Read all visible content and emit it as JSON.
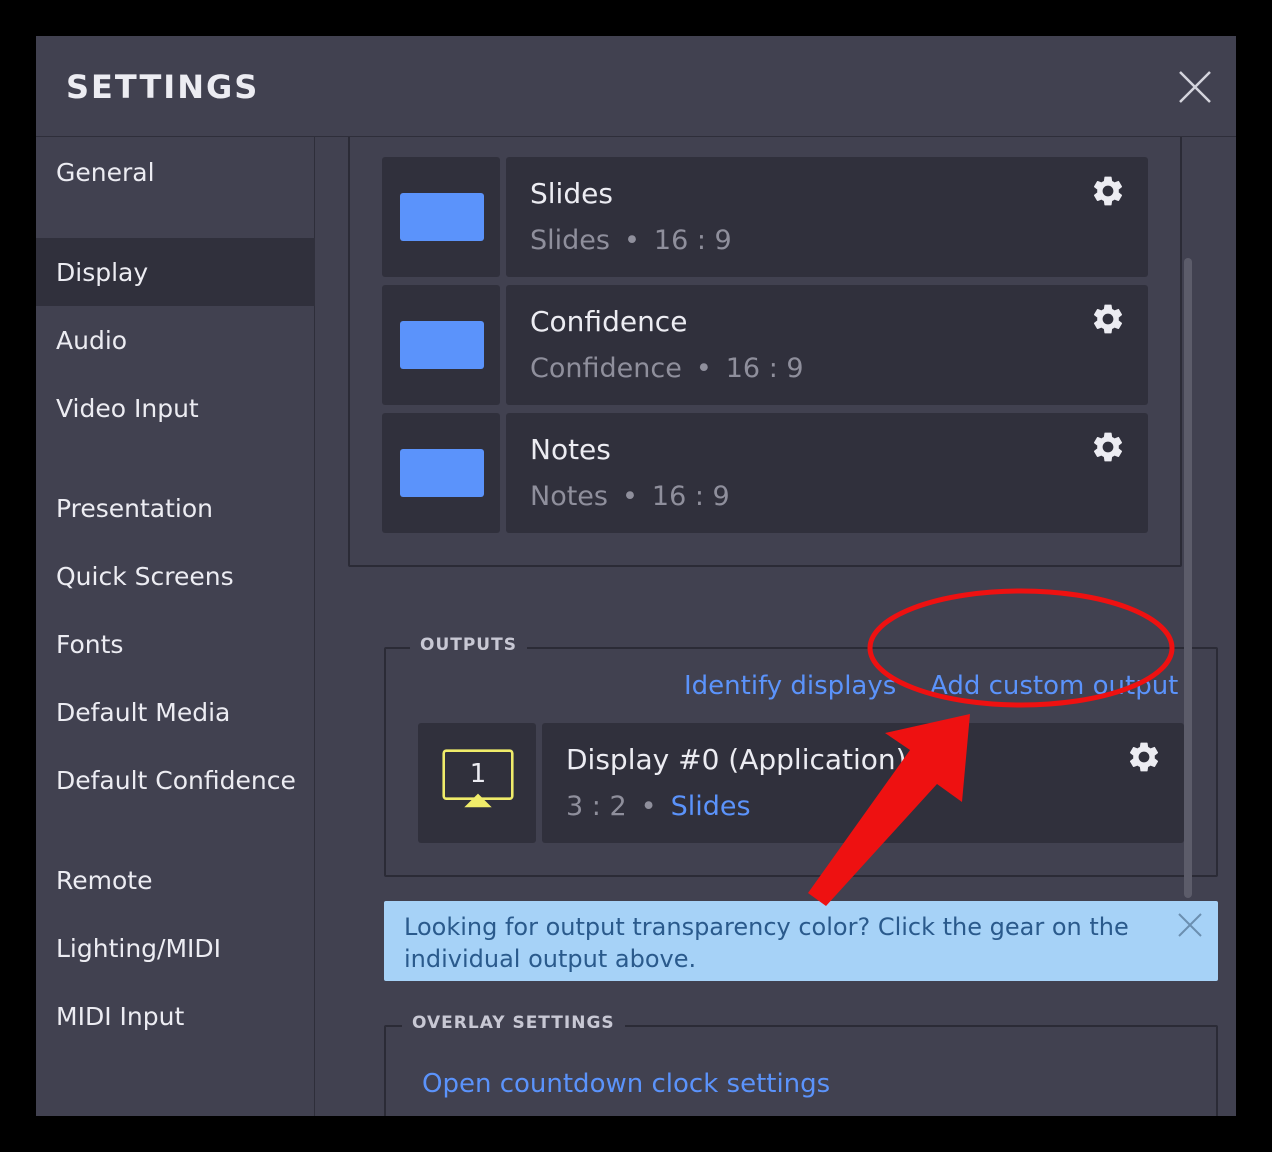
{
  "window": {
    "title": "SETTINGS"
  },
  "sidebar": {
    "items": [
      {
        "label": "General",
        "active": false
      },
      {
        "label": "Display",
        "active": true
      },
      {
        "label": "Audio",
        "active": false
      },
      {
        "label": "Video Input",
        "active": false
      },
      {
        "label": "Presentation",
        "active": false
      },
      {
        "label": "Quick Screens",
        "active": false
      },
      {
        "label": "Fonts",
        "active": false
      },
      {
        "label": "Default Media",
        "active": false
      },
      {
        "label": "Default Confidence",
        "active": false
      },
      {
        "label": "Remote",
        "active": false
      },
      {
        "label": "Lighting/MIDI",
        "active": false
      },
      {
        "label": "MIDI Input",
        "active": false
      }
    ]
  },
  "screens": [
    {
      "name": "Slides",
      "type": "Slides",
      "ratio": "16 : 9"
    },
    {
      "name": "Confidence",
      "type": "Confidence",
      "ratio": "16 : 9"
    },
    {
      "name": "Notes",
      "type": "Notes",
      "ratio": "16 : 9"
    }
  ],
  "outputs": {
    "label": "OUTPUTS",
    "identify_label": "Identify displays",
    "add_label": "Add custom output",
    "items": [
      {
        "icon_number": "1",
        "name": "Display #0 (Application)",
        "ratio": "3 : 2",
        "screen": "Slides"
      }
    ]
  },
  "notice": {
    "text": "Looking for output transparency color? Click the gear on the individual output above."
  },
  "overlay": {
    "label": "OVERLAY SETTINGS",
    "countdown_link": "Open countdown clock settings"
  },
  "colors": {
    "accent": "#5b93fb",
    "panel": "#414150",
    "card": "#30303c",
    "annotation": "#ee1111",
    "display_icon": "#f0ec6a"
  },
  "icons": {
    "close": "close-icon",
    "gear": "gear-icon",
    "screen": "screen-thumbnail-icon",
    "display": "display-monitor-icon"
  }
}
